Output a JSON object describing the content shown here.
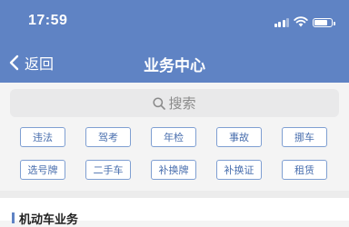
{
  "status_bar": {
    "time": "17:59"
  },
  "nav": {
    "back_label": "返回",
    "title": "业务中心"
  },
  "search": {
    "placeholder": "搜索"
  },
  "shortcuts": [
    {
      "label": "违法"
    },
    {
      "label": "驾考"
    },
    {
      "label": "年检"
    },
    {
      "label": "事故"
    },
    {
      "label": "挪车"
    },
    {
      "label": "选号牌"
    },
    {
      "label": "二手车"
    },
    {
      "label": "补换牌"
    },
    {
      "label": "补换证"
    },
    {
      "label": "租赁"
    }
  ],
  "section": {
    "title": "机动车业务"
  },
  "colors": {
    "header": "#5f83c4",
    "accent": "#4a6fae",
    "border": "#7f9fd2"
  },
  "icons": {
    "back": "chevron-left-icon",
    "search": "search-icon",
    "signal": "signal-icon",
    "wifi": "wifi-icon",
    "battery": "battery-icon"
  }
}
